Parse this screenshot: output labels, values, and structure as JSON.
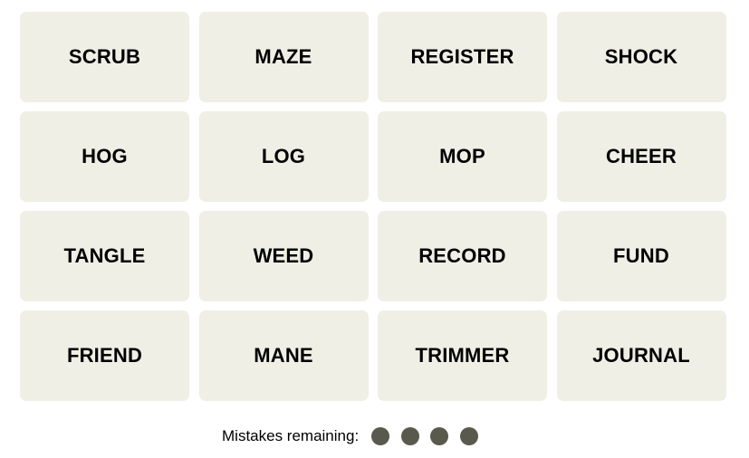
{
  "tiles": [
    "SCRUB",
    "MAZE",
    "REGISTER",
    "SHOCK",
    "HOG",
    "LOG",
    "MOP",
    "CHEER",
    "TANGLE",
    "WEED",
    "RECORD",
    "FUND",
    "FRIEND",
    "MANE",
    "TRIMMER",
    "JOURNAL"
  ],
  "mistakes": {
    "label": "Mistakes remaining:",
    "remaining": 4,
    "dot_color": "#5a594e"
  },
  "colors": {
    "tile_bg": "#efefe6"
  }
}
